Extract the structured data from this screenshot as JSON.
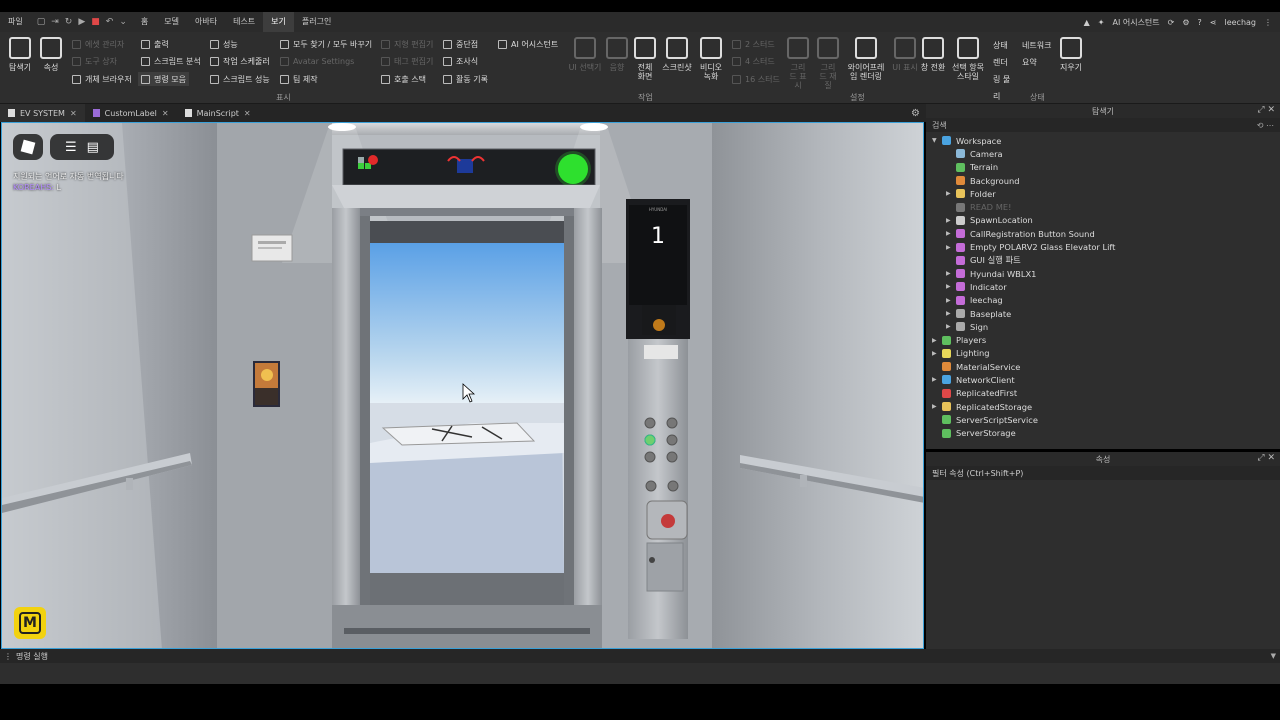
{
  "menubar": {
    "items": [
      "파일",
      "홈",
      "모델",
      "아바타",
      "테스트",
      "보기",
      "플러그인"
    ],
    "active_index": 5,
    "right": {
      "assistant": "AI 어시스턴트",
      "user": "leechag"
    }
  },
  "ribbon": {
    "explorer": "탐색기",
    "properties": "속성",
    "asset_manager": "에셋 관리자",
    "toolbox": "도구 상자",
    "object_browser": "개체 브라우저",
    "output": "출력",
    "script_analysis": "스크립트 분석",
    "command_bar": "명령 모음",
    "performance": "성능",
    "task_scheduler": "작업 스케줄러",
    "script_performance": "스크립트 성능",
    "find_replace": "모두 찾기 / 모두 바꾸기",
    "avatar_settings": "Avatar Settings",
    "team_create": "팀 제작",
    "terrain_editor": "지형 편집기",
    "tag_editor": "태그 편집기",
    "call_stack": "호출 스택",
    "breakpoints": "중단점",
    "watch": "조사식",
    "activity_log": "활동 기록",
    "ai_assistant": "AI 어시스턴트",
    "group_display": "표시",
    "select_ui": "UI 선택기",
    "sound": "음향",
    "fullscreen": "전체 화면",
    "screenshot": "스크린샷",
    "video_record": "비디오 녹화",
    "group_task": "작업",
    "stud2": "2 스터드",
    "stud4": "4 스터드",
    "stud16": "16 스터드",
    "grid_display": "그리드 표시",
    "grid_material": "그리드 재질",
    "wireframe": "와이어프레임 렌더링",
    "ui_display": "UI 표시",
    "switch": "창 전환",
    "selection_style": "선택 항목 스타일",
    "group_settings": "설정",
    "status_render": "상태 렌더링 물리",
    "network_summary": "네트워크 요약",
    "clear": "지우기",
    "group_status": "상태"
  },
  "tabs": [
    {
      "label": "EV SYSTEM",
      "color": "#dddddd"
    },
    {
      "label": "CustomLabel",
      "color": "#9b6cd8"
    },
    {
      "label": "MainScript",
      "color": "#dddddd"
    }
  ],
  "viewport": {
    "chat_line1": "지원되는 언어로 자동 번역됩니다",
    "chat_name": "KOREAHS:",
    "chat_msg": "L",
    "floor": "1",
    "panel_brand": "HYUNDAI"
  },
  "explorer": {
    "title": "탐색기",
    "search_placeholder": "검색",
    "items": [
      {
        "label": "Workspace",
        "depth": 0,
        "expanded": true,
        "color": "#4aa3e0"
      },
      {
        "label": "Camera",
        "depth": 1,
        "color": "#8bb8d8"
      },
      {
        "label": "Terrain",
        "depth": 1,
        "color": "#5fbf5f"
      },
      {
        "label": "Background",
        "depth": 1,
        "color": "#e08a3a"
      },
      {
        "label": "Folder",
        "depth": 1,
        "arrow": true,
        "color": "#e8c35a"
      },
      {
        "label": "READ ME!",
        "depth": 1,
        "dim": true,
        "color": "#777777"
      },
      {
        "label": "SpawnLocation",
        "depth": 1,
        "arrow": true,
        "color": "#cccccc"
      },
      {
        "label": "CallRegistration Button Sound",
        "depth": 1,
        "arrow": true,
        "color": "#c46cd8"
      },
      {
        "label": "Empty POLARV2 Glass Elevator Lift",
        "depth": 1,
        "arrow": true,
        "color": "#c46cd8"
      },
      {
        "label": "GUI 실행 파트",
        "depth": 1,
        "color": "#c46cd8"
      },
      {
        "label": "Hyundai WBLX1",
        "depth": 1,
        "arrow": true,
        "color": "#c46cd8"
      },
      {
        "label": "Indicator",
        "depth": 1,
        "arrow": true,
        "color": "#c46cd8"
      },
      {
        "label": "leechag",
        "depth": 1,
        "arrow": true,
        "color": "#c46cd8"
      },
      {
        "label": "Baseplate",
        "depth": 1,
        "arrow": true,
        "color": "#aaaaaa"
      },
      {
        "label": "Sign",
        "depth": 1,
        "arrow": true,
        "color": "#aaaaaa"
      },
      {
        "label": "Players",
        "depth": 0,
        "arrow": true,
        "color": "#5fbf5f"
      },
      {
        "label": "Lighting",
        "depth": 0,
        "arrow": true,
        "color": "#e8d85a"
      },
      {
        "label": "MaterialService",
        "depth": 0,
        "color": "#e08a3a"
      },
      {
        "label": "NetworkClient",
        "depth": 0,
        "arrow": true,
        "color": "#4aa3e0"
      },
      {
        "label": "ReplicatedFirst",
        "depth": 0,
        "color": "#e04848"
      },
      {
        "label": "ReplicatedStorage",
        "depth": 0,
        "arrow": true,
        "color": "#e8c35a"
      },
      {
        "label": "ServerScriptService",
        "depth": 0,
        "color": "#5fbf5f"
      },
      {
        "label": "ServerStorage",
        "depth": 0,
        "color": "#5fbf5f"
      }
    ]
  },
  "properties": {
    "title": "속성",
    "filter_placeholder": "필터 속성 (Ctrl+Shift+P)"
  },
  "command_bar": {
    "label": "명령 실행"
  }
}
